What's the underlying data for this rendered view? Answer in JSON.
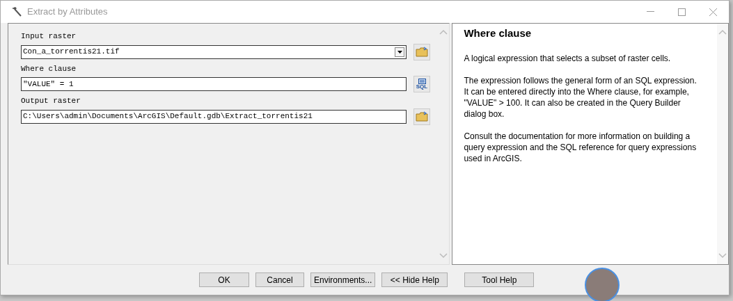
{
  "window": {
    "title": "Extract by Attributes"
  },
  "parameters": [
    {
      "label": "Input raster",
      "value": "Con_a_torrentis21.tif",
      "kind": "dropdown",
      "button": {
        "kind": "folder"
      }
    },
    {
      "label": "Where clause",
      "value": "\"VALUE\" = 1",
      "kind": "text",
      "button": {
        "kind": "sql",
        "text": "SQL"
      }
    },
    {
      "label": "Output raster",
      "value": "C:\\Users\\admin\\Documents\\ArcGIS\\Default.gdb\\Extract_torrentis21",
      "kind": "text",
      "button": {
        "kind": "folder"
      }
    }
  ],
  "help": {
    "title": "Where clause",
    "paragraphs": [
      "A logical expression that selects a subset of raster cells.",
      "The expression follows the general form of an SQL expression. It can be entered directly into the Where clause, for example, \"VALUE\" > 100. It can also be created in the Query Builder dialog box.",
      "Consult the documentation for more information on building a query expression and the SQL reference for query expressions used in ArcGIS."
    ]
  },
  "buttons": [
    {
      "label": "OK"
    },
    {
      "label": "Cancel"
    },
    {
      "label": "Environments..."
    },
    {
      "label": "<< Hide Help"
    },
    {
      "label": "Tool Help"
    }
  ]
}
